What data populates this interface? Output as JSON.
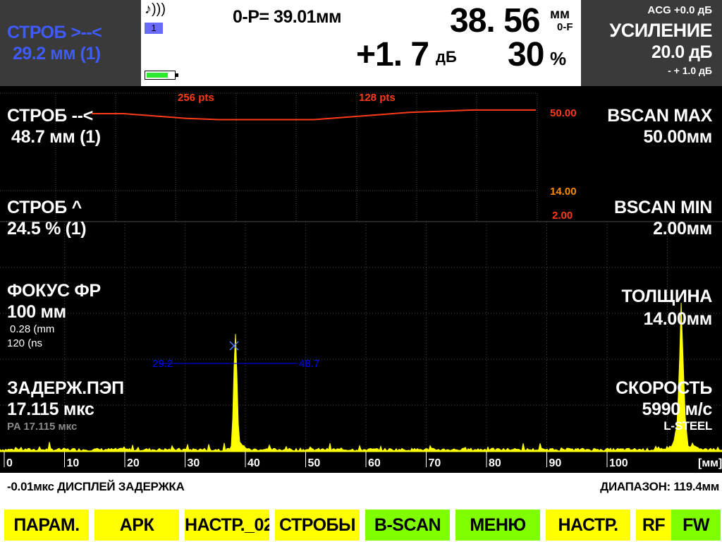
{
  "header": {
    "gate": {
      "line1": "СТРОБ >--<",
      "line2": "29.2 мм (1)"
    },
    "readout": {
      "sound_icon": "♪)))",
      "channel": "1",
      "op_label": "0-P=  39.01мм",
      "big_value": "38. 56",
      "big_unit": "мм",
      "big_sub": "0-F",
      "db_value": "+1. 7",
      "db_unit": "дБ",
      "pct_value": "30",
      "pct_unit": "%",
      "battery_level": 0.8
    },
    "gain": {
      "acg": "ACG +0.0 дБ",
      "title": "УСИЛЕНИЕ",
      "value": "20.0 дБ",
      "step": "- +  1.0 дБ"
    }
  },
  "left_panel": {
    "gate2_title": "СТРОБ --<",
    "gate2_value": "48.7 мм (1)",
    "gate3_title": "СТРОБ ^",
    "gate3_value": "24.5 % (1)",
    "focus_title": "ФОКУС ФР",
    "focus_value": "100 мм",
    "focus_sub1": "0.28 (mm",
    "focus_sub2": "120 (ns",
    "delay_title": "ЗАДЕРЖ.ПЭП",
    "delay_value": "17.115 мкс",
    "delay_sub": "PA 17.115 мкс"
  },
  "right_panel": {
    "bscan_max_title": "BSCAN MAX",
    "bscan_max_value": "50.00мм",
    "bscan_min_title": "BSCAN MIN",
    "bscan_min_value": "2.00мм",
    "thickness_title": "ТОЛЩИНА",
    "thickness_value": "14.00мм",
    "velocity_title": "СКОРОСТЬ",
    "velocity_value": "5990 м/с",
    "material": "L-STEEL"
  },
  "bscan": {
    "pts_left": "256 pts",
    "pts_right": "128 pts",
    "scale_max": "50.00",
    "scale_mid": "14.00",
    "scale_min": "2.00",
    "trace_values_mm": [
      45.0,
      45.0,
      44.0,
      43.0,
      42.5,
      42.5,
      42.5,
      42.5,
      43.5,
      44.5,
      45.5,
      46.0,
      46.5,
      46.5,
      46.5
    ]
  },
  "gate_marker": {
    "start_label": "29.2",
    "end_label": "48.7",
    "start_mm": 26.0,
    "end_mm": 48.7
  },
  "x_axis": {
    "unit": "[мм]",
    "ticks": [
      "0",
      "10",
      "20",
      "30",
      "40",
      "50",
      "60",
      "70",
      "80",
      "90",
      "100"
    ]
  },
  "status": {
    "left": "-0.01мкс  ДИСПЛЕЙ ЗАДЕРЖКА",
    "right": "ДИАПАЗОН: 119.4мм"
  },
  "softkeys": [
    {
      "label": "ПАРАМ.",
      "color": "#ffff00"
    },
    {
      "label": "АРК",
      "color": "#ffff00"
    },
    {
      "label": "НАСТР._02",
      "color": "#ffff00"
    },
    {
      "label": "СТРОБЫ",
      "color": "#ffff00"
    },
    {
      "label": "B-SCAN",
      "color": "#80ff00"
    },
    {
      "label": "МЕНЮ",
      "color": "#80ff00"
    },
    {
      "label": "НАСТР.",
      "color": "#ffff00"
    },
    {
      "label": "RF",
      "color": "#ffff00"
    },
    {
      "label": "FW",
      "color": "#80ff00"
    }
  ],
  "colors": {
    "ascan": "#ffff00",
    "bscan_trace": "#ff3a1a",
    "gate": "#0000ff",
    "grid": "#4a4a4a",
    "accent_blue": "#3f5bff"
  }
}
